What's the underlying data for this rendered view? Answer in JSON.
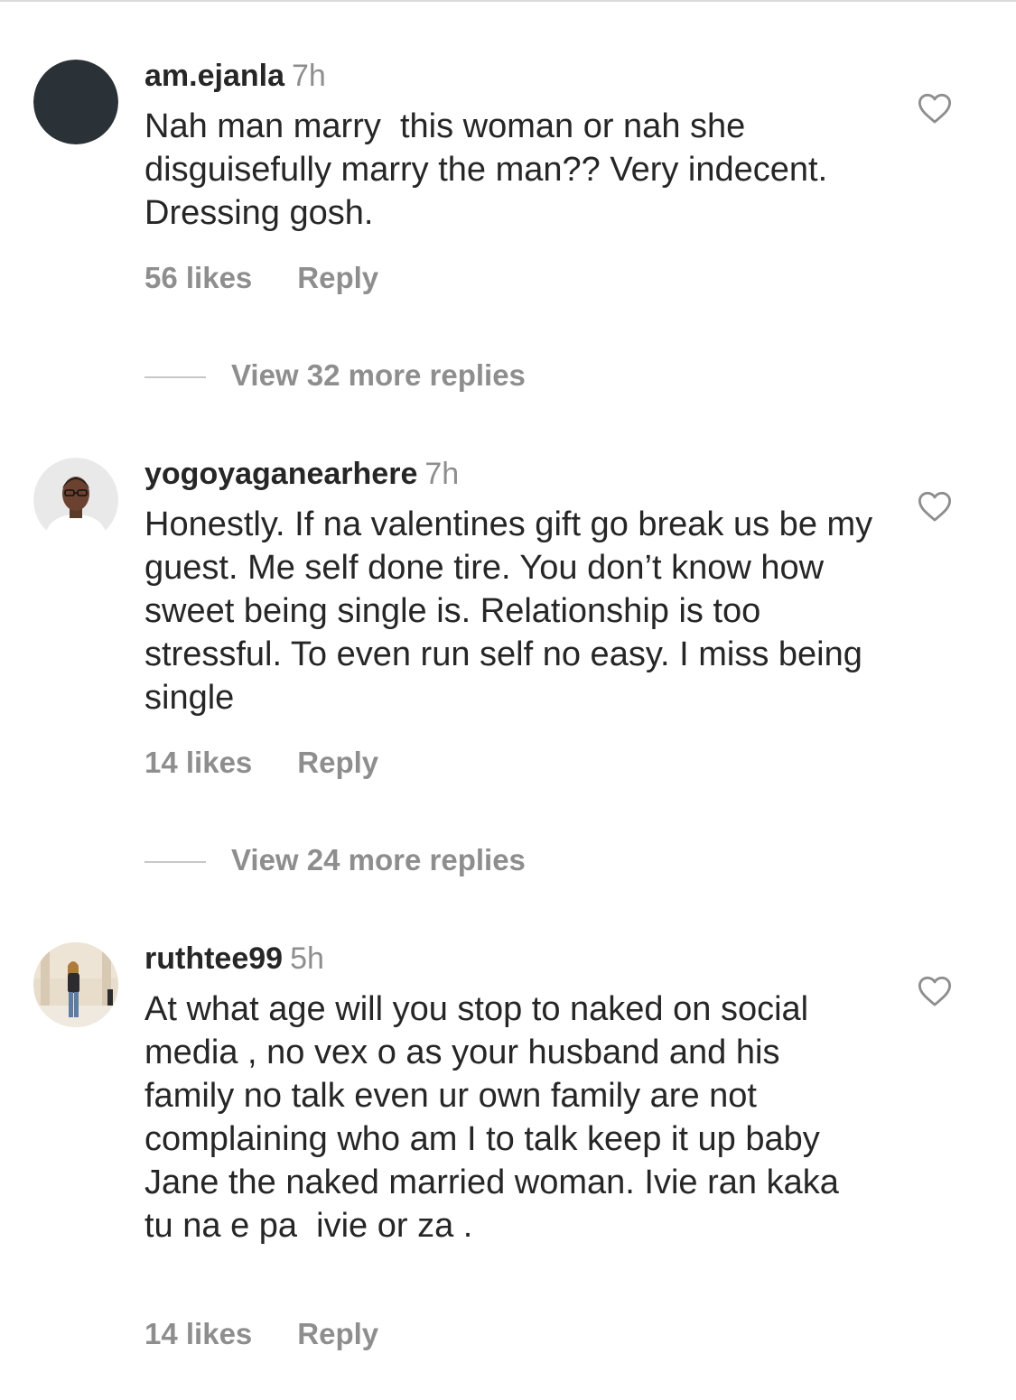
{
  "colors": {
    "text": "#262626",
    "secondary": "#8e8e8e",
    "divider": "#dbdbdb"
  },
  "comments": [
    {
      "username": "am.ejanla",
      "time": "7h",
      "text": "Nah man marry  this woman or nah she disguisefully marry the man?? Very indecent. Dressing gosh.",
      "likes": "56 likes",
      "reply_label": "Reply",
      "view_replies": "View 32 more replies",
      "avatar": "dark-circle-avatar"
    },
    {
      "username": "yogoyaganearhere",
      "time": "7h",
      "text": "Honestly. If na valentines gift go break us be my guest. Me self done tire. You don’t know how sweet being single is. Relationship is too stressful. To even run self no easy. I miss being single",
      "likes": "14 likes",
      "reply_label": "Reply",
      "view_replies": "View 24 more replies",
      "avatar": "man-with-glasses-avatar"
    },
    {
      "username": "ruthtee99",
      "time": "5h",
      "text": "At what age will you stop to naked on social media , no vex o as your husband and his family no talk even ur own family are not complaining who am I to talk keep it up baby Jane the naked married woman. Ivie ran kaka tu na e pa  ivie or za .",
      "likes": "14 likes",
      "reply_label": "Reply",
      "avatar": "woman-standing-avatar"
    }
  ]
}
